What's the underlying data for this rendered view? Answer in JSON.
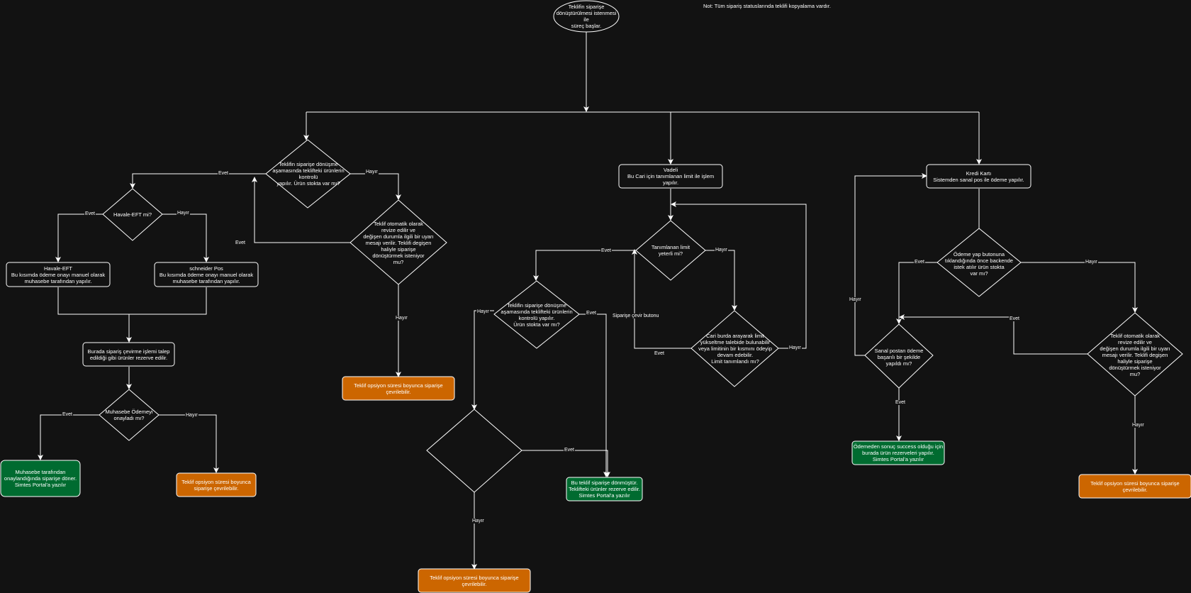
{
  "colors": {
    "background": "#121212",
    "stroke": "#ffffff",
    "green": "#006b30",
    "orange": "#cc6600"
  },
  "note": "Not: Tüm sipariş statuslarında teklifi kopyalama vardır.",
  "nodes": {
    "start": "Teklifin siparişe\ndönüştürülmesi istenmesi ile\nsüreç başlar.",
    "stock_check_left": "Teklifin siparişe dönüşme\naşamasında teklifteki ürünlerin\nkontrolü\nyapılır. Ürün stokta var mı?",
    "auto_revise_left": "Teklif otomatik olarak\nrevize edilir ve\ndeğişen durumla ilgili bir uyarı\nmesajı verilir. Teklifi degişen\nhaliyle siparişe\ndönüştürmek isteniyor\nmu?",
    "havale_q": "Havale-EFT mi?",
    "havale_box": "Havale-EFT\nBu kısımda ödeme onayı manuel olarak\nmuhasebe tarafından yapılır.",
    "schneider_box": "schneider Pos\nBu kısımda ödeme onayı manuel olarak\nmuhasebe tarafından yapılır.",
    "reserve_box": "Burada sipariş çevirme işlemi talep\nedildiği gibi ürünler rezerve edilir.",
    "accounting_q": "Muhasebe Ödemeyi\nonayladı mı?",
    "accounting_yes": "Muhasebe tarafından\nonaylandığında siparişe döner.\nSimtes Portal'a yazılır",
    "accounting_no": "Teklif opsiyon süresi boyunca\nsiparişe çevrilebilir.",
    "left_option": "Teklif opsiyon süresi boyunca siparişe çevrilebilir.",
    "vadeli": "Vadeli\nBu Cari için tanımlanan limit ile işlem yapılır.",
    "limit_q": "Tanımlanan limit\nyeterli mi?",
    "stock_check_mid": "Teklifin siparişe dönüşme\naşamasında teklifteki ürünlerin\nkontrolü yapılır.\nÜrün stokta var mı?",
    "call_q": "Cari burda arayarak limit\nyükseltme talebide bulunabilir\nveya limitinin bir kısmını ödeyip\ndevam edebilir.\nLimit tanımlandı mı?",
    "auto_revise_mid": "Teklif otomatik olarak\nrevize edilir ve\ndeğişen durumla ilgili bir uyarı\nmesajı verilir. Teklifi degişen\nhaliyle siparişe\ndönüştürmek isteniyor\nmu?",
    "mid_done": "Bu teklif siparişe dönmüştür.\nTeklifteki ürünler rezerve edilir.\nSimtes Portal'a yazılır",
    "mid_option": "Teklif opsiyon süresi boyunca siparişe çevrilebilir.",
    "kredi": "Kredi Kartı\nSistemden sanal pos ile ödeme yapılır.",
    "pay_q": "Ödeme yap butonuna\ntıklandığında önce backende\nistek atılır  ürün stokta\nvar mı?",
    "sanal_q": "Sanal postan ödeme\nbaşarılı bir şekilde\nyapıldı mı?",
    "auto_revise_right": "Teklif otomatik olarak\nrevize edilir ve\ndeğişen durumla ilgili bir uyarı\nmesajı verilir. Teklifi degişen\nhaliyle siparişe\ndönüştürmek isteniyor\nmu?",
    "right_done": "Ödemeden sonuç success olduğu için\nburada ürün rezerveleri yapılır.\nSimtes Portal'a yazılır",
    "right_option": "Teklif opsiyon süresi boyunca siparişe çevrilebilir."
  },
  "edge_labels": {
    "evet": "Evet",
    "hayir": "Hayır",
    "siparise_cevir": "Siparişe çevir butonu"
  }
}
